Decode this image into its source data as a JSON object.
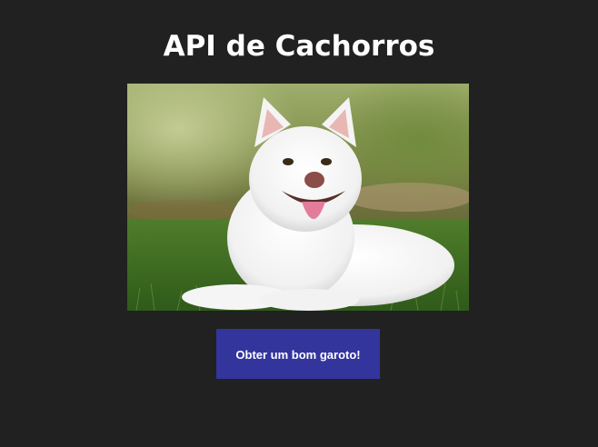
{
  "page": {
    "title": "API de Cachorros",
    "button_label": "Obter um bom garoto!"
  },
  "colors": {
    "background": "#212121",
    "button": "#33349c",
    "text": "#ffffff"
  },
  "image": {
    "subject": "dog-photo"
  }
}
